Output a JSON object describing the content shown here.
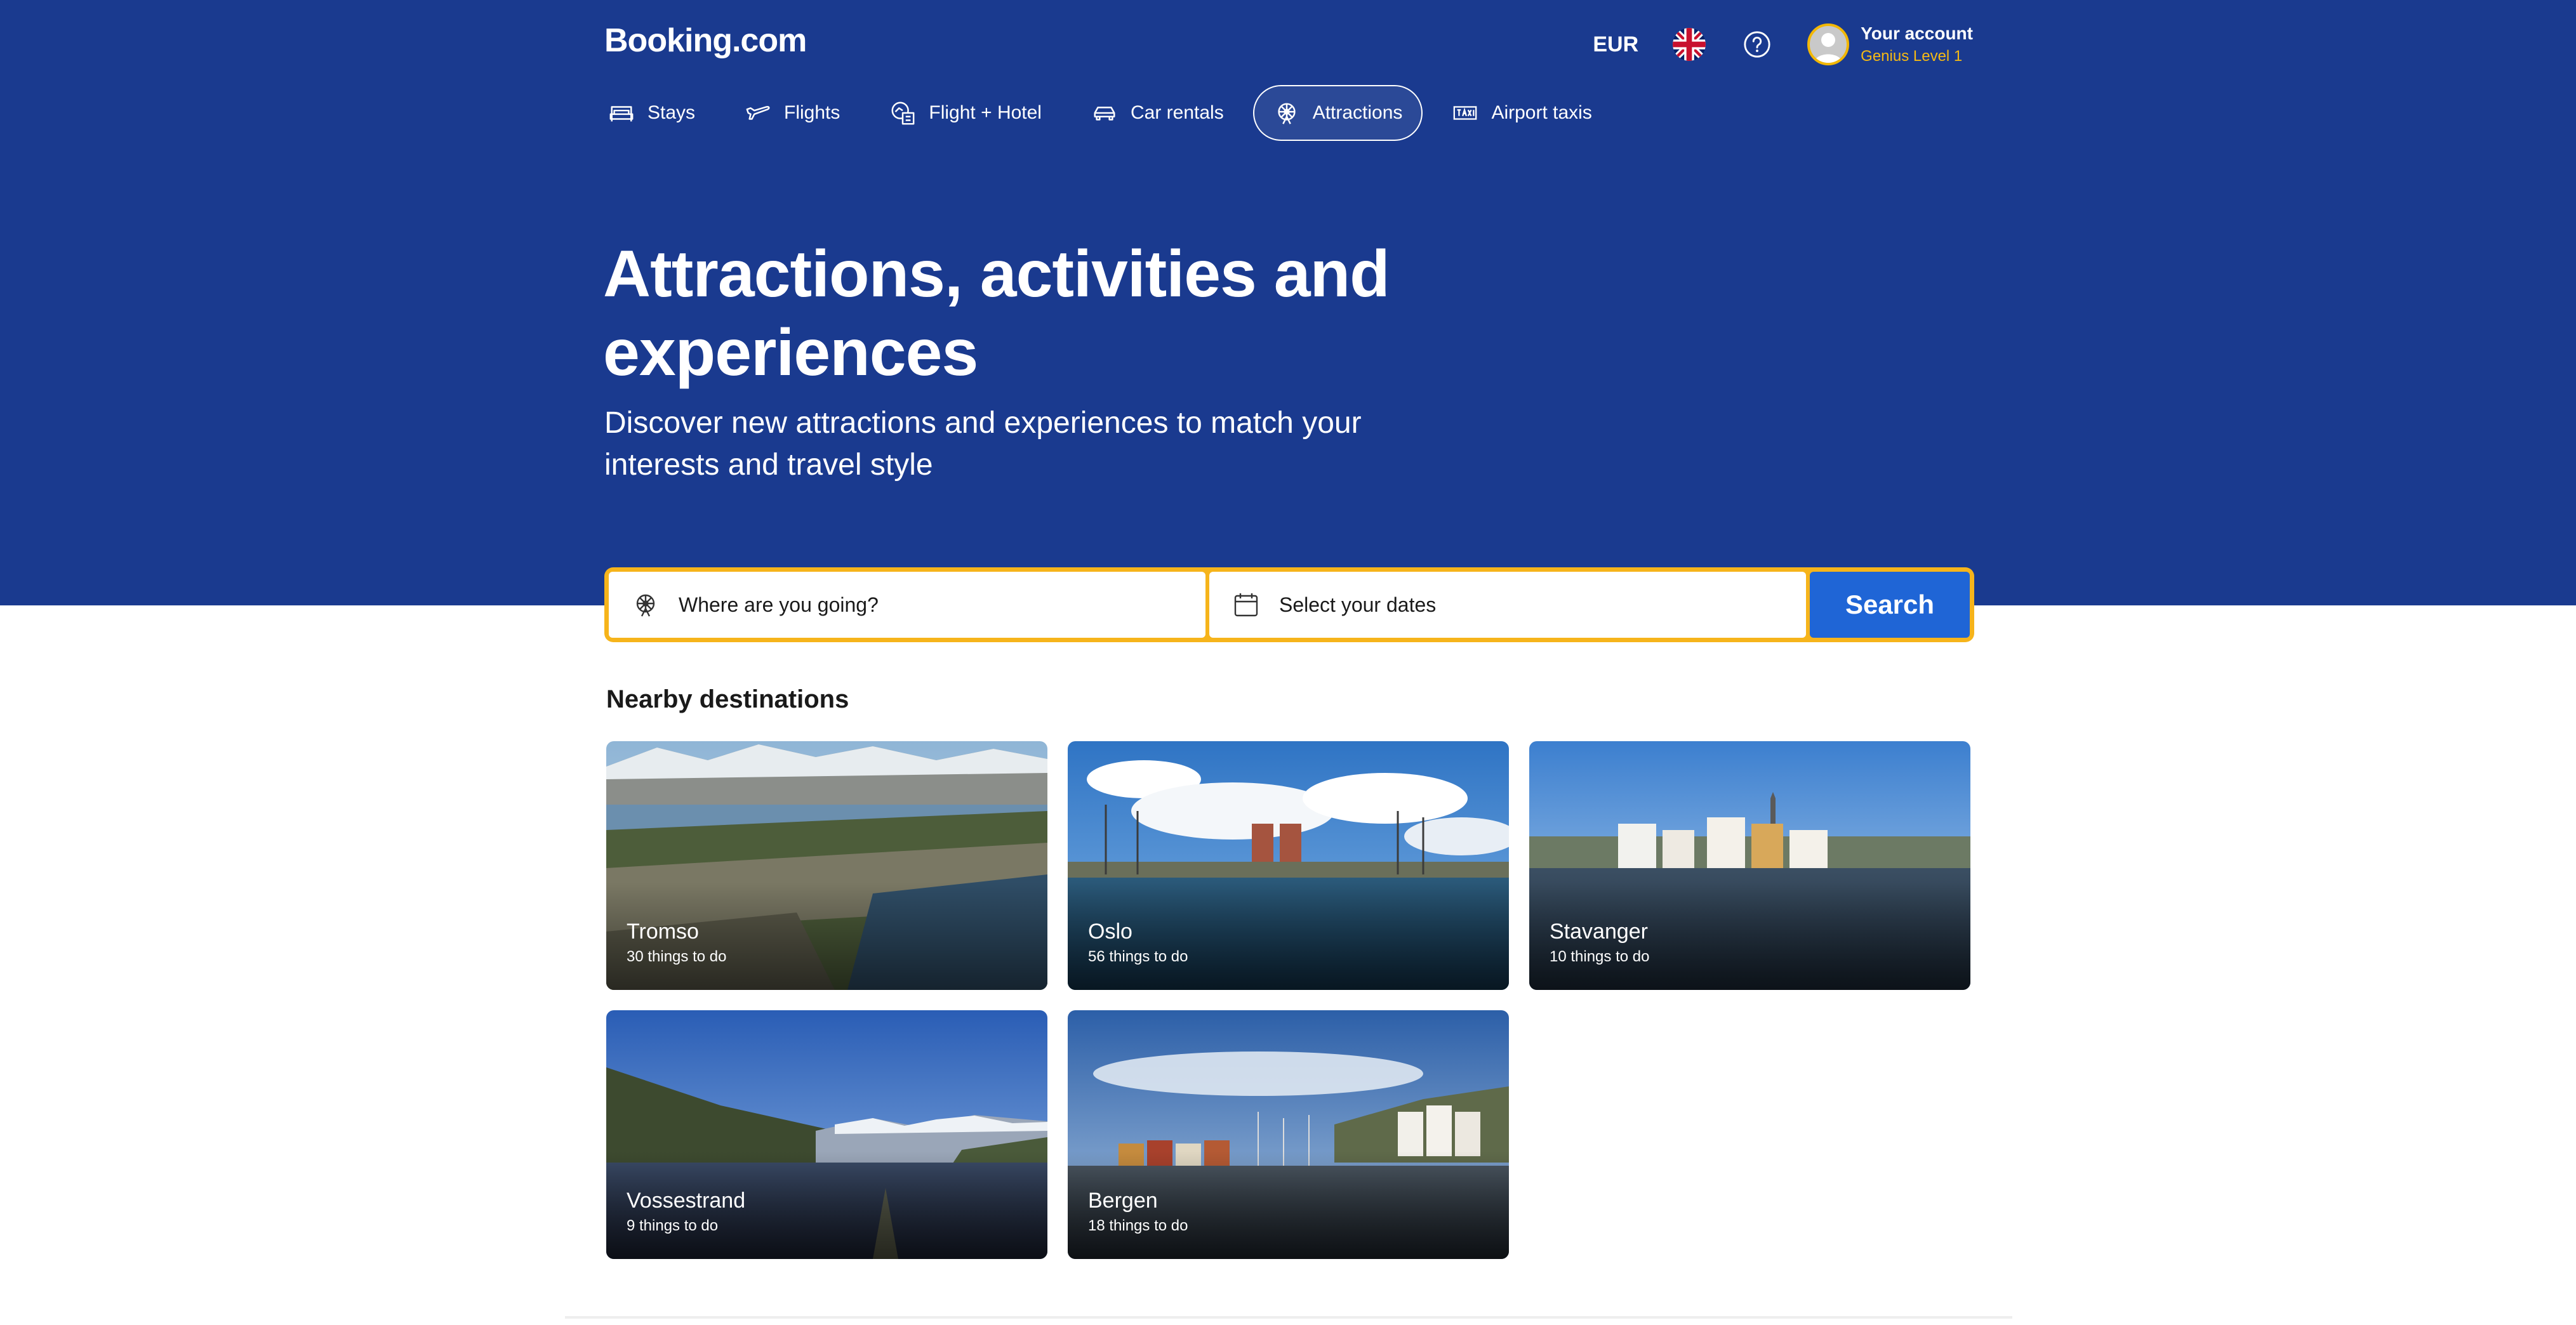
{
  "header": {
    "brand": "Booking.com",
    "currency": "EUR",
    "account_name": "Your account",
    "account_level": "Genius Level 1"
  },
  "nav": {
    "items": [
      {
        "label": "Stays",
        "icon": "bed-icon"
      },
      {
        "label": "Flights",
        "icon": "plane-icon"
      },
      {
        "label": "Flight + Hotel",
        "icon": "flight-hotel-icon"
      },
      {
        "label": "Car rentals",
        "icon": "car-icon"
      },
      {
        "label": "Attractions",
        "icon": "attractions-icon",
        "active": true
      },
      {
        "label": "Airport taxis",
        "icon": "taxi-icon"
      }
    ]
  },
  "hero": {
    "title": "Attractions, activities and experiences",
    "subtitle": "Discover new attractions and experiences to match your interests and travel style"
  },
  "search": {
    "destination_placeholder": "Where are you going?",
    "dates_placeholder": "Select your dates",
    "button_label": "Search"
  },
  "nearby": {
    "title": "Nearby destinations",
    "cards": [
      {
        "name": "Tromso",
        "count": "30 things to do"
      },
      {
        "name": "Oslo",
        "count": "56 things to do"
      },
      {
        "name": "Stavanger",
        "count": "10 things to do"
      },
      {
        "name": "Vossestrand",
        "count": "9 things to do"
      },
      {
        "name": "Bergen",
        "count": "18 things to do"
      }
    ]
  },
  "colors": {
    "brand_blue": "#1a3a8f",
    "search_border": "#f6b41b",
    "search_button": "#1f65d6",
    "genius": "#f5b914"
  }
}
